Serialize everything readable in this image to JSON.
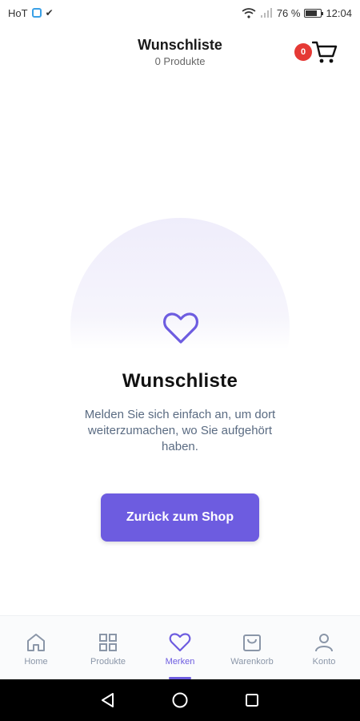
{
  "status_bar": {
    "app_label": "HoT",
    "battery": "76 %",
    "battery_level": 0.76,
    "time": "12:04"
  },
  "header": {
    "title": "Wunschliste",
    "subtitle": "0 Produkte",
    "cart_count": "0"
  },
  "empty_state": {
    "title": "Wunschliste",
    "message": "Melden Sie sich einfach an, um dort weiterzumachen, wo Sie aufgehört haben.",
    "button_label": "Zurück zum Shop"
  },
  "bottom_nav": {
    "items": [
      {
        "label": "Home",
        "icon": "home-icon"
      },
      {
        "label": "Produkte",
        "icon": "grid-icon"
      },
      {
        "label": "Merken",
        "icon": "heart-icon",
        "active": true
      },
      {
        "label": "Warenkorb",
        "icon": "basket-icon"
      },
      {
        "label": "Konto",
        "icon": "user-icon"
      }
    ]
  },
  "colors": {
    "accent": "#6d5ce0",
    "badge": "#e53935",
    "muted": "#8a96a8"
  }
}
